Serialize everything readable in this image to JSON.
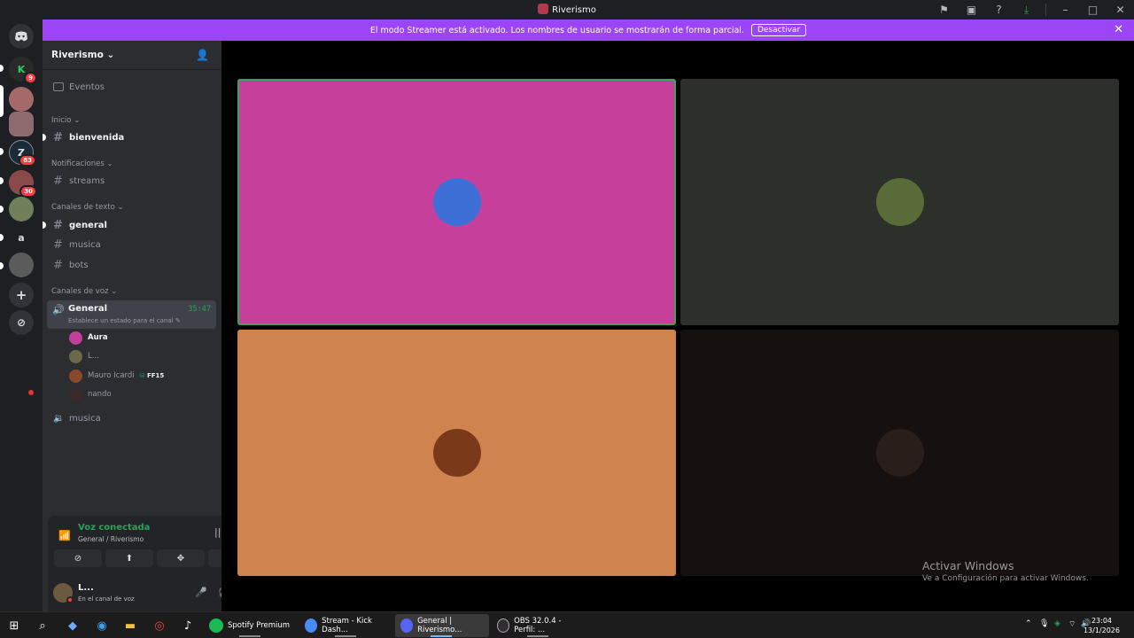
{
  "window": {
    "title": "Riverismo"
  },
  "banner": {
    "text": "El modo Streamer está activado. Los nombres de usuario se mostrarán de forma parcial.",
    "button": "Desactivar"
  },
  "rail": {
    "servers": [
      {
        "name": "server-1",
        "badge": "9",
        "color": "#2a2a2a"
      },
      {
        "name": "server-2",
        "badge": "",
        "color": "#a46a6a"
      },
      {
        "name": "server-3",
        "badge": "",
        "color": "#8d6b6f"
      },
      {
        "name": "server-4",
        "badge": "83",
        "color": "#1b2b3a"
      },
      {
        "name": "server-5",
        "badge": "30",
        "color": "#8a4a4a"
      },
      {
        "name": "server-6",
        "badge": "",
        "color": "#6e7f5a"
      },
      {
        "name": "server-7",
        "letter": "a",
        "color": "#1e1f22"
      },
      {
        "name": "server-8",
        "badge": "",
        "color": "#5b5b5b"
      }
    ]
  },
  "server": {
    "name": "Riverismo",
    "events": "Eventos",
    "categories": {
      "inicio": "Inicio",
      "notificaciones": "Notificaciones",
      "texto": "Canales de texto",
      "voz": "Canales de voz"
    },
    "channels": {
      "bienvenida": "bienvenida",
      "streams": "streams",
      "general": "general",
      "musica": "musica",
      "bots": "bots"
    },
    "voice": {
      "general": {
        "name": "General",
        "time": "35:47",
        "status": "Establece un estado para el canal"
      },
      "users": [
        {
          "name": "Aura",
          "color": "#c23f9a"
        },
        {
          "name": "L...",
          "color": "#6a6a4a"
        },
        {
          "name": "Mauro Icardi",
          "tag": "FF15",
          "color": "#8a4a2a"
        },
        {
          "name": "nando",
          "color": "#3a2a2a"
        }
      ],
      "musica": "musica"
    }
  },
  "voice_panel": {
    "title": "Voz conectada",
    "subtitle": "General / Riverismo",
    "user_name": "L...",
    "user_status": "En el canal de voz"
  },
  "tiles": [
    {
      "name": "aura",
      "bg": "#c53f9b",
      "avatar": "#3d6fd6",
      "speaking": true
    },
    {
      "name": "user-l",
      "bg": "#2d2f2b",
      "avatar": "#5a6b3a",
      "speaking": false
    },
    {
      "name": "mauro-icardi",
      "bg": "#cf844f",
      "avatar": "#7a3a1a",
      "speaking": false
    },
    {
      "name": "nando",
      "bg": "#16110f",
      "avatar": "#2a1e1a",
      "speaking": false
    }
  ],
  "watermark": {
    "title": "Activar Windows",
    "subtitle": "Ve a Configuración para activar Windows."
  },
  "taskbar": {
    "apps": [
      {
        "label": "Spotify Premium",
        "color": "#1db954"
      },
      {
        "label": "Stream - Kick Dash...",
        "color": "#4a8af4"
      },
      {
        "label": "General | Riverismo...",
        "color": "#5865f2"
      },
      {
        "label": "OBS 32.0.4 - Perfil: ...",
        "color": "#302e31"
      }
    ],
    "time": "23:04",
    "date": "13/1/2026"
  }
}
